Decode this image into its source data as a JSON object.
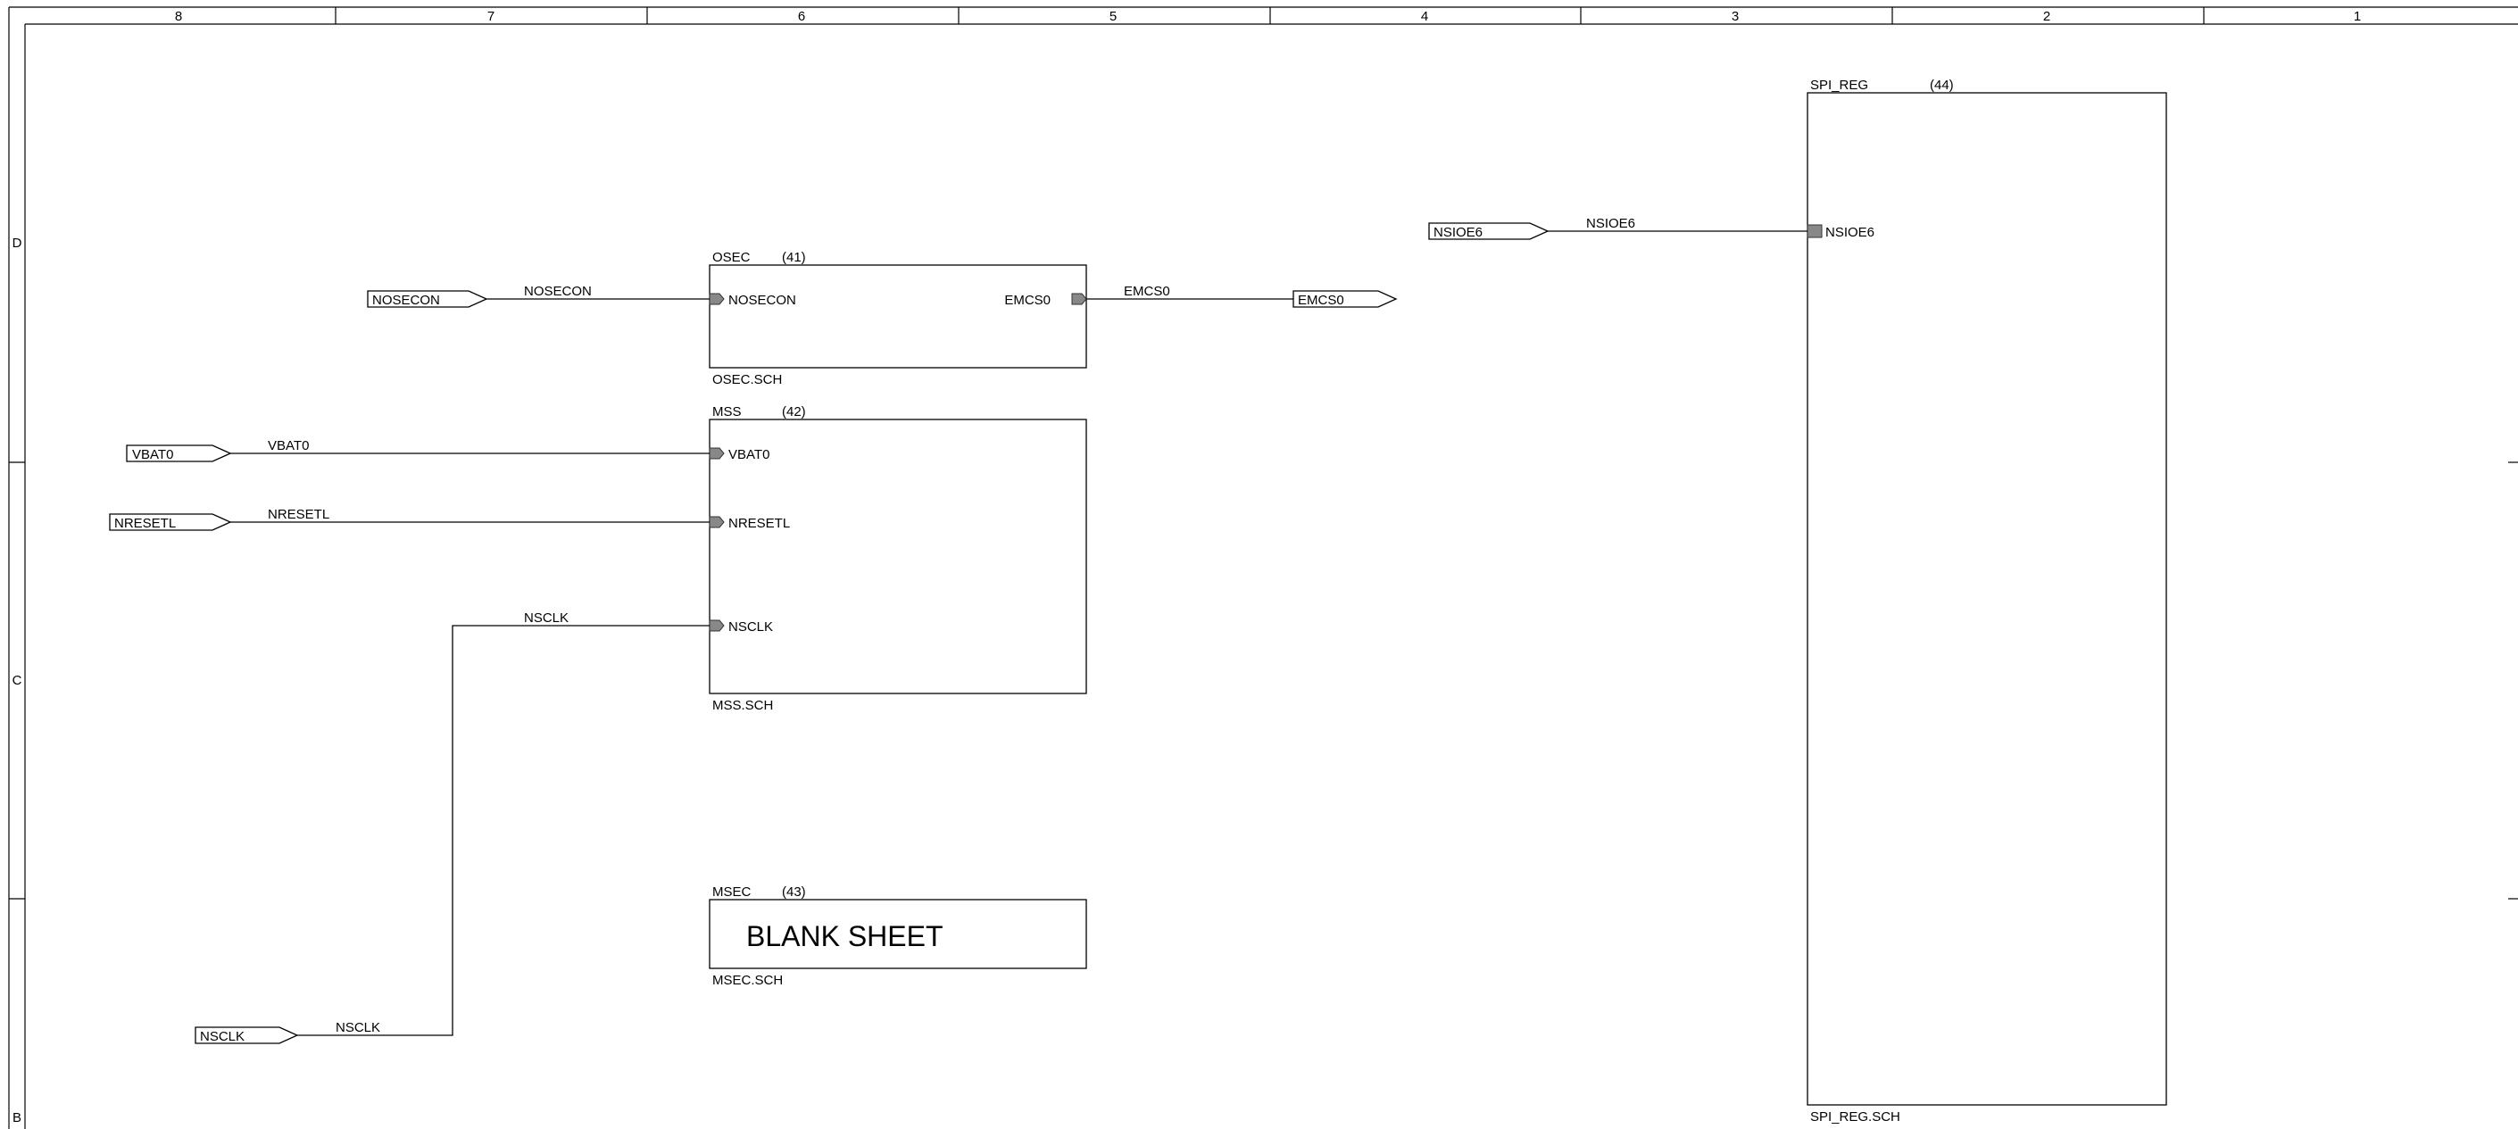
{
  "columns": [
    "8",
    "7",
    "6",
    "5",
    "4",
    "3",
    "2",
    "1"
  ],
  "rows": [
    "D",
    "C",
    "B"
  ],
  "sheets": {
    "osec": {
      "name": "OSEC",
      "number": "(41)",
      "file": "OSEC.SCH",
      "pins": {
        "in": "NOSECON",
        "out": "EMCS0"
      }
    },
    "mss": {
      "name": "MSS",
      "number": "(42)",
      "file": "MSS.SCH",
      "pins": {
        "vbat": "VBAT0",
        "nreset": "NRESETL",
        "nsclk": "NSCLK"
      }
    },
    "msec": {
      "name": "MSEC",
      "number": "(43)",
      "file": "MSEC.SCH",
      "body_text": "BLANK SHEET"
    },
    "spi_reg": {
      "name": "SPI_REG",
      "number": "(44)",
      "file": "SPI_REG.SCH",
      "pins": {
        "nsioe": "NSIOE6"
      }
    }
  },
  "ports": {
    "nosecon": "NOSECON",
    "emcs0": "EMCS0",
    "vbat0": "VBAT0",
    "nresetl": "NRESETL",
    "nsclk": "NSCLK",
    "nsioe6": "NSIOE6"
  },
  "nets": {
    "nosecon": "NOSECON",
    "emcs0": "EMCS0",
    "vbat0": "VBAT0",
    "nresetl": "NRESETL",
    "nsclk_top": "NSCLK",
    "nsclk_bottom": "NSCLK",
    "nsioe6": "NSIOE6"
  }
}
